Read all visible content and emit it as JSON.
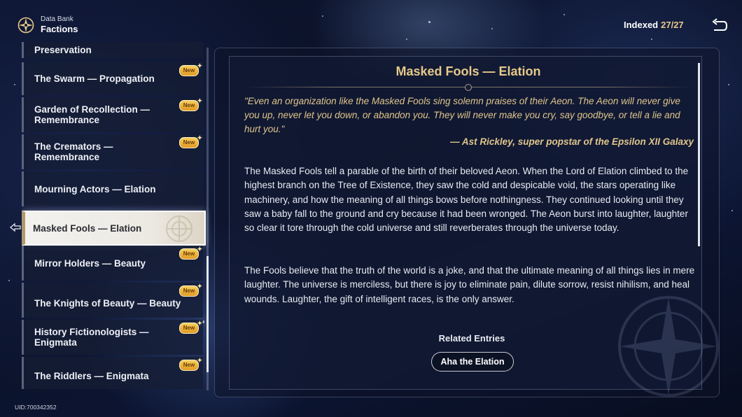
{
  "header": {
    "subtitle": "Data Bank",
    "title": "Factions",
    "logo_icon": "data-bank-compass-icon"
  },
  "indexed": {
    "label": "Indexed",
    "count": "27/27"
  },
  "back_icon": "return-arrow-icon",
  "list": {
    "items": [
      {
        "label": "Preservation",
        "new": false,
        "selected": false
      },
      {
        "label": "The Swarm — Propagation",
        "new": true,
        "selected": false
      },
      {
        "label": "Garden of Recollection — Remembrance",
        "new": true,
        "selected": false
      },
      {
        "label": "The Cremators — Remembrance",
        "new": true,
        "selected": false
      },
      {
        "label": "Mourning Actors — Elation",
        "new": false,
        "selected": false
      },
      {
        "label": "Masked Fools — Elation",
        "new": false,
        "selected": true
      },
      {
        "label": "Mirror Holders — Beauty",
        "new": true,
        "selected": false
      },
      {
        "label": "The Knights of Beauty — Beauty",
        "new": true,
        "selected": false
      },
      {
        "label": "History Fictionologists — Enigmata",
        "new": true,
        "selected": false
      },
      {
        "label": "The Riddlers — Enigmata",
        "new": true,
        "selected": false
      }
    ],
    "new_badge_label": "New"
  },
  "detail": {
    "title": "Masked Fools — Elation",
    "quote": "\"Even an organization like the Masked Fools sing solemn praises of their Aeon. The Aeon will never give you up, never let you down, or abandon you. They will never make you cry, say goodbye, or tell a lie and hurt you.\"",
    "attribution": "— Ast Rickley, super popstar of the Epsilon XII Galaxy",
    "paragraphs": [
      "The Masked Fools tell a parable of the birth of their beloved Aeon. When the Lord of Elation climbed to the highest branch on the Tree of Existence, they saw the cold and despicable void, the stars operating like machinery, and how the meaning of all things bows before nothingness. They continued looking until they saw a baby fall to the ground and cry because it had been wronged. The Aeon burst into laughter, laughter so clear it tore through the cold universe and still reverberates through the universe today.",
      "The Fools believe that the truth of the world is a joke, and that the ultimate meaning of all things lies in mere laughter. The universe is merciless, but there is joy to eliminate pain, dilute sorrow, resist nihilism, and heal wounds. Laughter, the gift of intelligent races, is the only answer."
    ],
    "related_heading": "Related Entries",
    "related_button": "Aha the Elation"
  },
  "uid": "UID:700342352"
}
